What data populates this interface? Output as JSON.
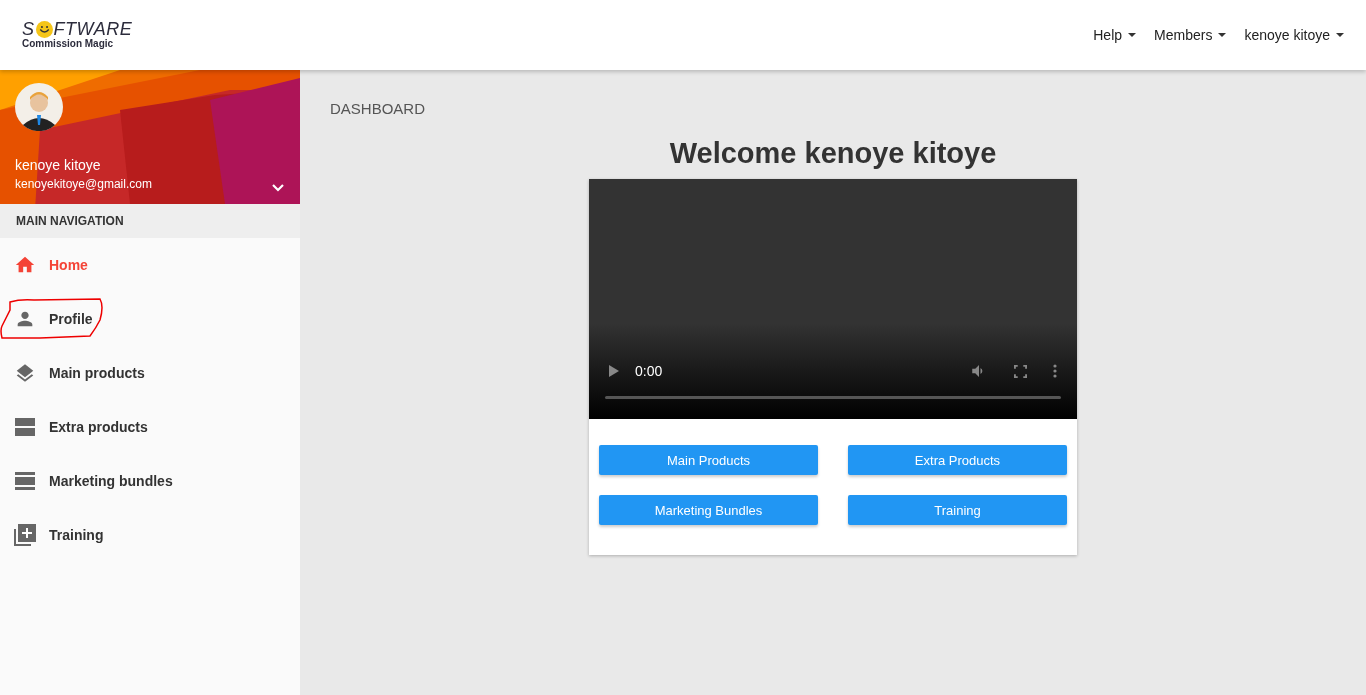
{
  "logo": {
    "lead": "S",
    "rest": "FTWARE",
    "tagline": "Commission Magic"
  },
  "top_menu": [
    {
      "label": "Help"
    },
    {
      "label": "Members"
    },
    {
      "label": "kenoye kitoye"
    }
  ],
  "user": {
    "name": "kenoye kitoye",
    "email": "kenoyekitoye@gmail.com"
  },
  "nav_header": "MAIN NAVIGATION",
  "nav": [
    {
      "label": "Home",
      "kind": "home",
      "selected": true,
      "circled": false
    },
    {
      "label": "Profile",
      "kind": "person",
      "selected": false,
      "circled": true
    },
    {
      "label": "Main products",
      "kind": "layers",
      "selected": false,
      "circled": false
    },
    {
      "label": "Extra products",
      "kind": "split",
      "selected": false,
      "circled": false
    },
    {
      "label": "Marketing bundles",
      "kind": "list",
      "selected": false,
      "circled": false
    },
    {
      "label": "Training",
      "kind": "add",
      "selected": false,
      "circled": false
    }
  ],
  "breadcrumb": "DASHBOARD",
  "heading": "Welcome kenoye kitoye",
  "video": {
    "time": "0:00"
  },
  "buttons": [
    {
      "label": "Main Products"
    },
    {
      "label": "Extra Products"
    },
    {
      "label": "Marketing Bundles"
    },
    {
      "label": "Training"
    }
  ]
}
